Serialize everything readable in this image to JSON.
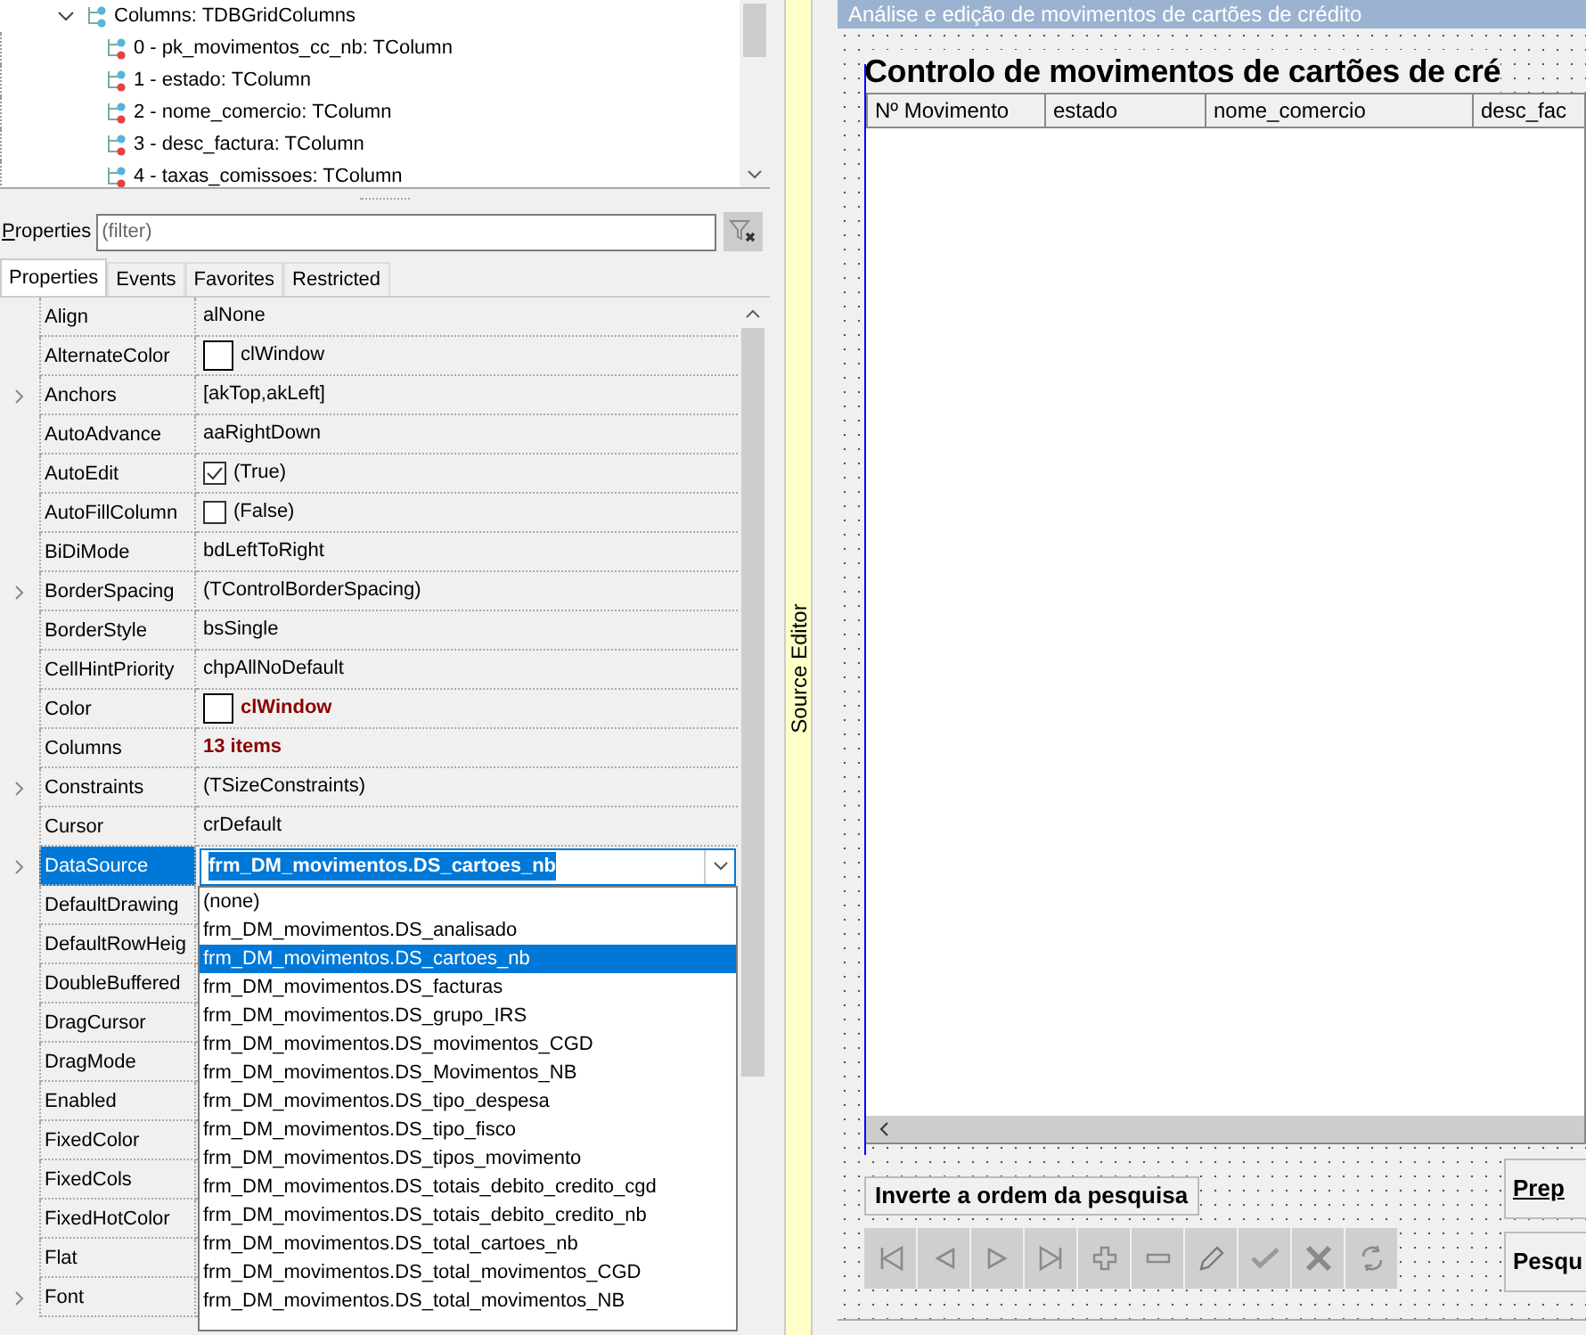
{
  "component_tree": [
    {
      "label": "Columns: TDBGridColumns",
      "expanded": true,
      "children": [
        {
          "label": "0 - pk_movimentos_cc_nb: TColumn"
        },
        {
          "label": "1 - estado: TColumn"
        },
        {
          "label": "2 - nome_comercio: TColumn"
        },
        {
          "label": "3 - desc_factura: TColumn"
        },
        {
          "label": "4 - taxas_comissoes: TColumn"
        }
      ]
    }
  ],
  "filter": {
    "label": "Properties",
    "placeholder": "(filter)"
  },
  "tabs": [
    {
      "label": "Properties",
      "selected": true
    },
    {
      "label": "Events",
      "selected": false
    },
    {
      "label": "Favorites",
      "selected": false
    },
    {
      "label": "Restricted",
      "selected": false
    }
  ],
  "properties": [
    {
      "name": "Align",
      "value": "alNone",
      "expandable": false,
      "kind": "text",
      "modified": false,
      "selected": false
    },
    {
      "name": "AlternateColor",
      "value": "clWindow",
      "expandable": false,
      "kind": "color",
      "modified": false,
      "selected": false
    },
    {
      "name": "Anchors",
      "value": "[akTop,akLeft]",
      "expandable": true,
      "kind": "text",
      "modified": false,
      "selected": false
    },
    {
      "name": "AutoAdvance",
      "value": "aaRightDown",
      "expandable": false,
      "kind": "text",
      "modified": false,
      "selected": false
    },
    {
      "name": "AutoEdit",
      "value": "(True)",
      "expandable": false,
      "kind": "checkbox",
      "checked": true,
      "modified": false,
      "selected": false
    },
    {
      "name": "AutoFillColumn",
      "value": "(False)",
      "expandable": false,
      "kind": "checkbox",
      "checked": false,
      "modified": false,
      "selected": false
    },
    {
      "name": "BiDiMode",
      "value": "bdLeftToRight",
      "expandable": false,
      "kind": "text",
      "modified": false,
      "selected": false
    },
    {
      "name": "BorderSpacing",
      "value": "(TControlBorderSpacing)",
      "expandable": true,
      "kind": "text",
      "modified": false,
      "selected": false
    },
    {
      "name": "BorderStyle",
      "value": "bsSingle",
      "expandable": false,
      "kind": "text",
      "modified": false,
      "selected": false
    },
    {
      "name": "CellHintPriority",
      "value": "chpAllNoDefault",
      "expandable": false,
      "kind": "text",
      "modified": false,
      "selected": false
    },
    {
      "name": "Color",
      "value": "clWindow",
      "expandable": false,
      "kind": "color",
      "modified": true,
      "selected": false
    },
    {
      "name": "Columns",
      "value": "13 items",
      "expandable": false,
      "kind": "text",
      "modified": true,
      "selected": false
    },
    {
      "name": "Constraints",
      "value": "(TSizeConstraints)",
      "expandable": true,
      "kind": "text",
      "modified": false,
      "selected": false
    },
    {
      "name": "Cursor",
      "value": "crDefault",
      "expandable": false,
      "kind": "text",
      "modified": false,
      "selected": false
    },
    {
      "name": "DataSource",
      "value": "frm_DM_movimentos.DS_cartoes_nb",
      "expandable": true,
      "kind": "combo",
      "modified": true,
      "selected": true
    },
    {
      "name": "DefaultDrawing",
      "expandable": false,
      "kind": "text",
      "selected": false
    },
    {
      "name": "DefaultRowHeig",
      "expandable": false,
      "kind": "text",
      "selected": false
    },
    {
      "name": "DoubleBuffered",
      "expandable": false,
      "kind": "text",
      "selected": false
    },
    {
      "name": "DragCursor",
      "expandable": false,
      "kind": "text",
      "selected": false
    },
    {
      "name": "DragMode",
      "expandable": false,
      "kind": "text",
      "selected": false
    },
    {
      "name": "Enabled",
      "expandable": false,
      "kind": "text",
      "selected": false
    },
    {
      "name": "FixedColor",
      "expandable": false,
      "kind": "text",
      "selected": false
    },
    {
      "name": "FixedCols",
      "expandable": false,
      "kind": "text",
      "selected": false
    },
    {
      "name": "FixedHotColor",
      "expandable": false,
      "kind": "text",
      "selected": false
    },
    {
      "name": "Flat",
      "expandable": false,
      "kind": "text",
      "selected": false
    },
    {
      "name": "Font",
      "expandable": true,
      "kind": "text",
      "selected": false
    }
  ],
  "dropdown": [
    {
      "label": "(none)",
      "selected": false
    },
    {
      "label": "frm_DM_movimentos.DS_analisado",
      "selected": false
    },
    {
      "label": "frm_DM_movimentos.DS_cartoes_nb",
      "selected": true
    },
    {
      "label": "frm_DM_movimentos.DS_facturas",
      "selected": false
    },
    {
      "label": "frm_DM_movimentos.DS_grupo_IRS",
      "selected": false
    },
    {
      "label": "frm_DM_movimentos.DS_movimentos_CGD",
      "selected": false
    },
    {
      "label": "frm_DM_movimentos.DS_Movimentos_NB",
      "selected": false
    },
    {
      "label": "frm_DM_movimentos.DS_tipo_despesa",
      "selected": false
    },
    {
      "label": "frm_DM_movimentos.DS_tipo_fisco",
      "selected": false
    },
    {
      "label": "frm_DM_movimentos.DS_tipos_movimento",
      "selected": false
    },
    {
      "label": "frm_DM_movimentos.DS_totais_debito_credito_cgd",
      "selected": false
    },
    {
      "label": "frm_DM_movimentos.DS_totais_debito_credito_nb",
      "selected": false
    },
    {
      "label": "frm_DM_movimentos.DS_total_cartoes_nb",
      "selected": false
    },
    {
      "label": "frm_DM_movimentos.DS_total_movimentos_CGD",
      "selected": false
    },
    {
      "label": "frm_DM_movimentos.DS_total_movimentos_NB",
      "selected": false
    }
  ],
  "source_editor": {
    "label": "Source Editor"
  },
  "form": {
    "caption": "Análise e edição de movimentos de cartões de crédito",
    "heading": "Controlo de movimentos de cartões de cré",
    "grid_columns": [
      "Nº Movimento",
      "estado",
      "nome_comercio",
      "desc_fac"
    ],
    "invert_button": "Inverte a ordem da pesquisa",
    "side_buttons": [
      {
        "label": "Prep",
        "mnemonic": true
      },
      {
        "label": "Pesqu",
        "mnemonic": false
      }
    ]
  }
}
